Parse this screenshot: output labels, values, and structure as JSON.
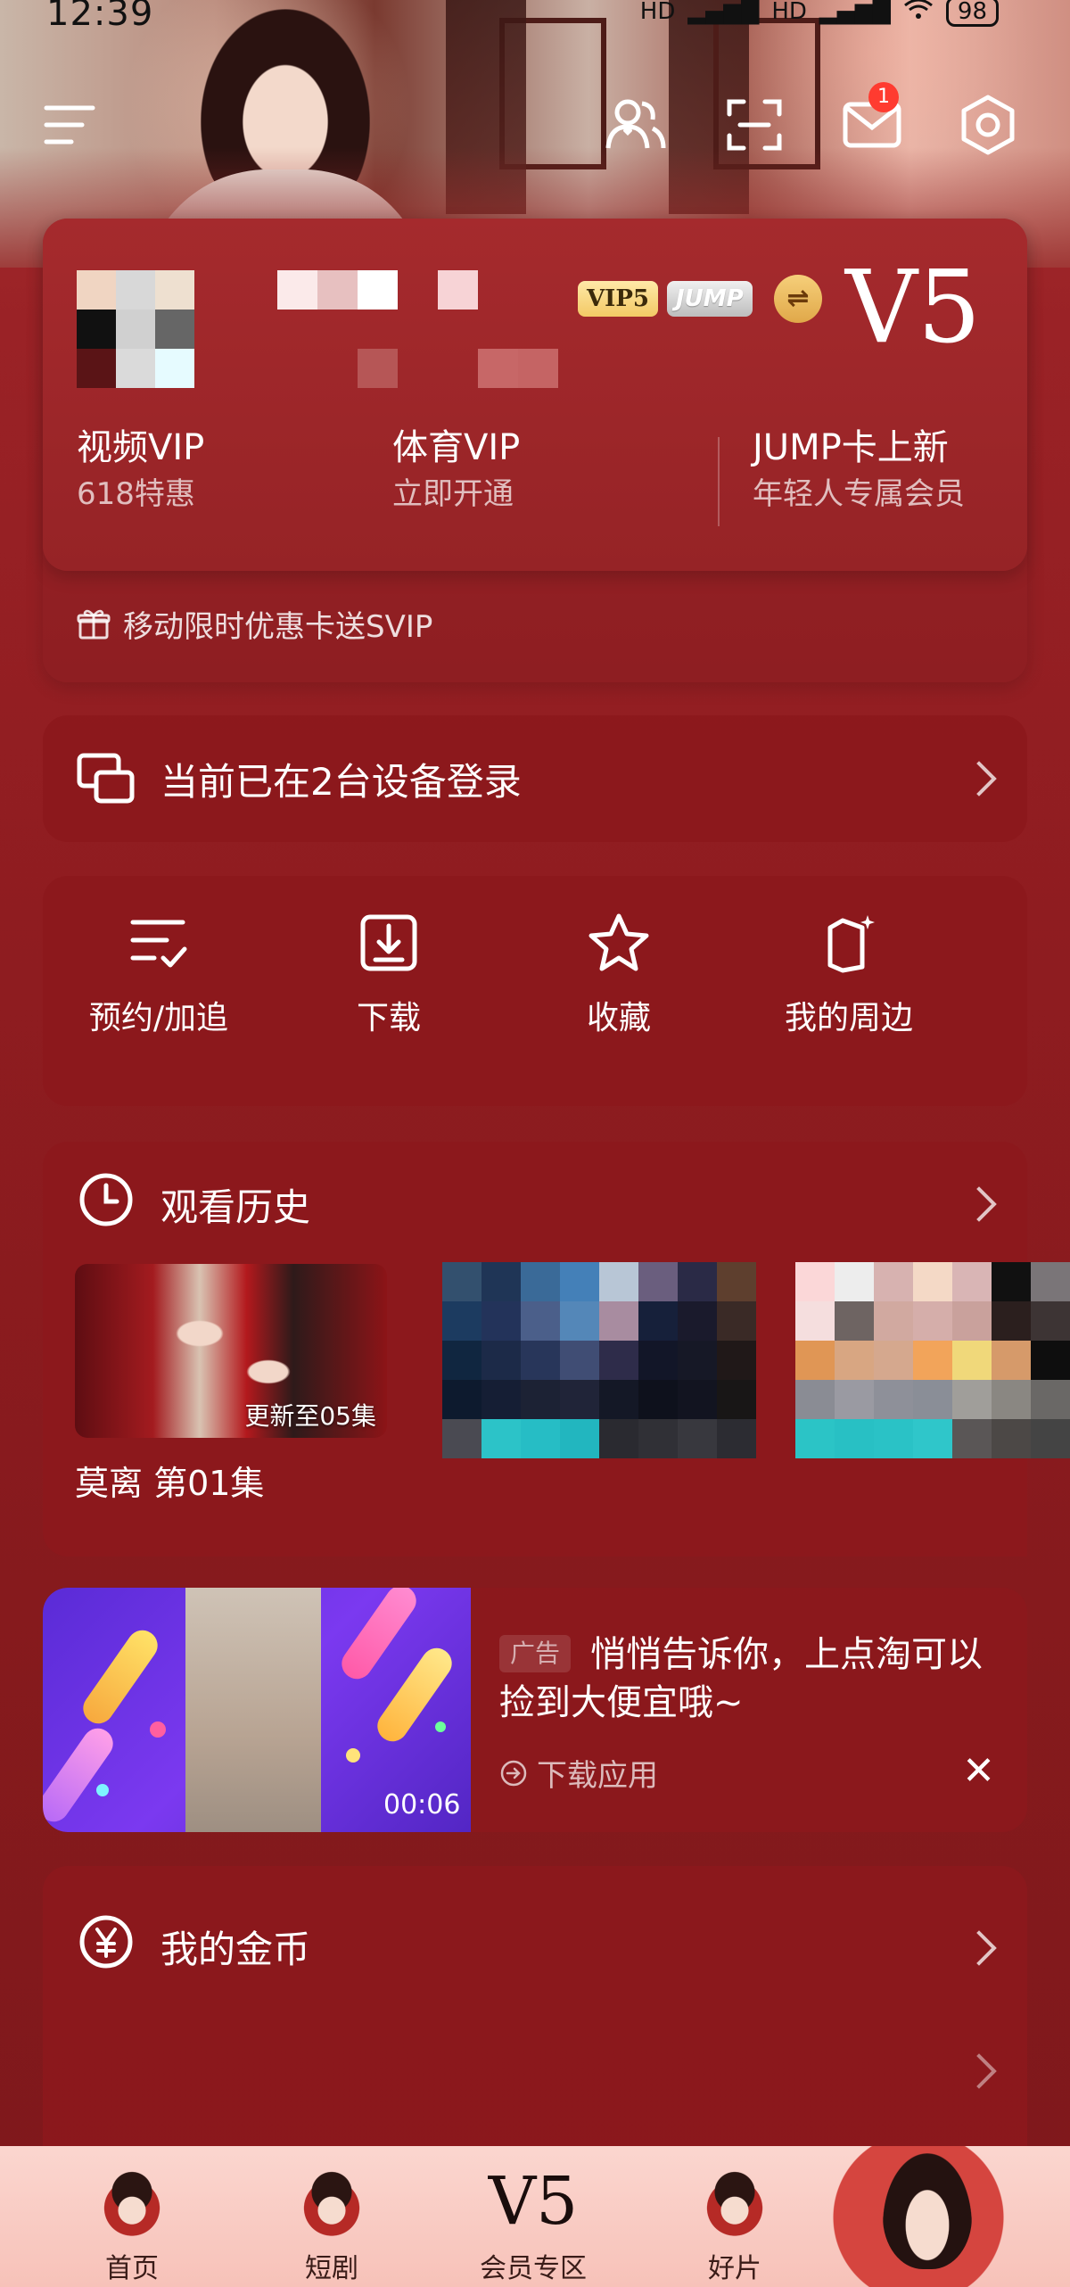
{
  "status": {
    "time": "12:39",
    "signal1": "HD",
    "signal2": "HD",
    "battery": "98"
  },
  "topbar": {
    "badge_count": "1",
    "icons": [
      "menu-icon",
      "friends-icon",
      "scan-icon",
      "mail-icon",
      "settings-icon"
    ]
  },
  "member": {
    "tag_vip": "VIP5",
    "tag_jump": "JUMP",
    "swap_symbol": "⇌",
    "level": "V5",
    "cols": [
      {
        "title": "视频VIP",
        "sub": "618特惠"
      },
      {
        "title": "体育VIP",
        "sub": "立即开通"
      },
      {
        "title": "JUMP卡上新",
        "sub": "年轻人专属会员"
      }
    ],
    "promo": "移动限时优惠卡送SVIP"
  },
  "devices": {
    "label": "当前已在2台设备登录"
  },
  "quick": [
    {
      "label": "预约/加追",
      "icon": "reserve-list-icon"
    },
    {
      "label": "下载",
      "icon": "download-icon"
    },
    {
      "label": "收藏",
      "icon": "star-icon"
    },
    {
      "label": "我的周边",
      "icon": "merch-icon"
    }
  ],
  "history": {
    "title": "观看历史",
    "items": [
      {
        "caption": "更新至05集",
        "title": "莫离 第01集"
      }
    ]
  },
  "ad": {
    "tag": "广告",
    "text": "悄悄告诉你，上点淘可以捡到大便宜哦~",
    "download": "下载应用",
    "duration": "00:06",
    "close": "✕"
  },
  "coins": {
    "title": "我的金币"
  },
  "nav": {
    "items": [
      {
        "label": "首页"
      },
      {
        "label": "短剧"
      },
      {
        "label": "会员专区",
        "logo": "V5"
      },
      {
        "label": "好片"
      }
    ]
  },
  "colors": {
    "accent": "#9a2226",
    "card": "#8c181c",
    "nav_bg": "#f7c2b9"
  }
}
